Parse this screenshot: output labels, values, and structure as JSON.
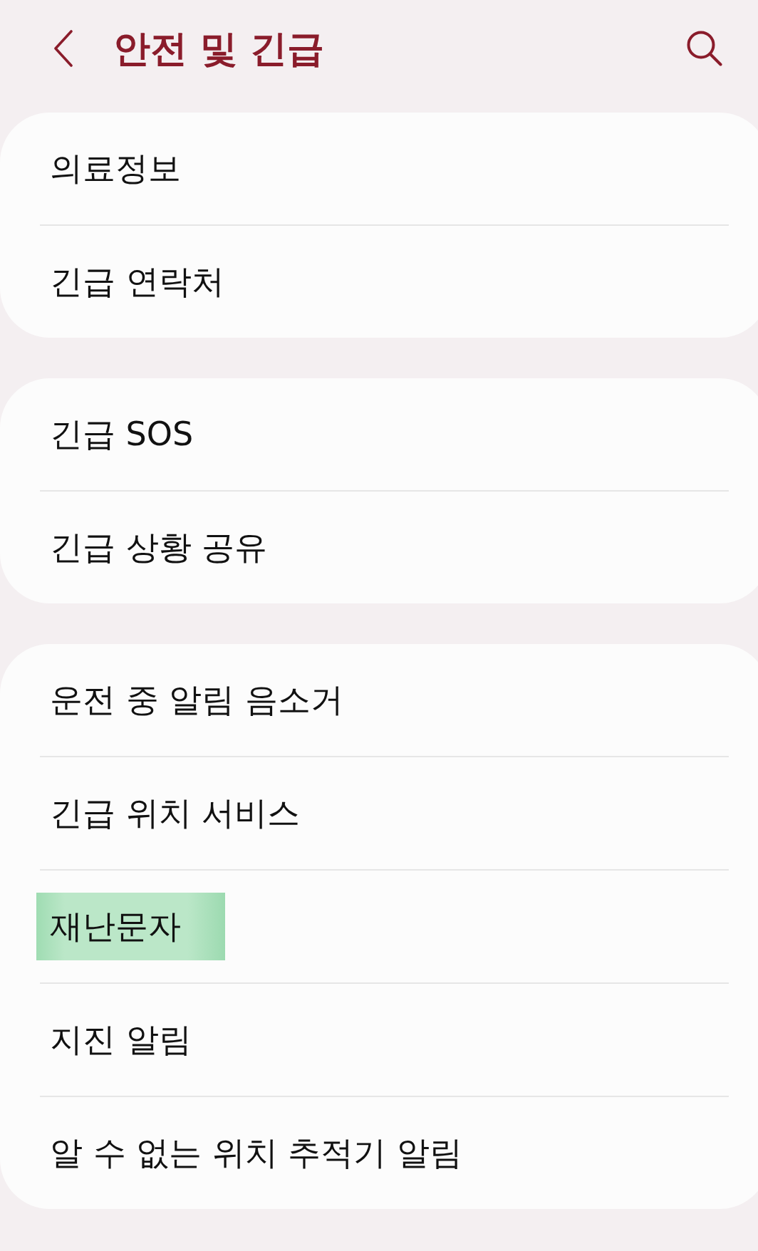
{
  "header": {
    "title": "안전 및 긴급"
  },
  "groups": [
    {
      "items": [
        {
          "label": "의료정보",
          "highlighted": false
        },
        {
          "label": "긴급 연락처",
          "highlighted": false
        }
      ]
    },
    {
      "items": [
        {
          "label": "긴급 SOS",
          "highlighted": false
        },
        {
          "label": "긴급 상황 공유",
          "highlighted": false
        }
      ]
    },
    {
      "items": [
        {
          "label": "운전 중 알림 음소거",
          "highlighted": false
        },
        {
          "label": "긴급 위치 서비스",
          "highlighted": false
        },
        {
          "label": "재난문자",
          "highlighted": true
        },
        {
          "label": "지진 알림",
          "highlighted": false
        },
        {
          "label": "알 수 없는 위치 추적기 알림",
          "highlighted": false
        }
      ]
    }
  ]
}
